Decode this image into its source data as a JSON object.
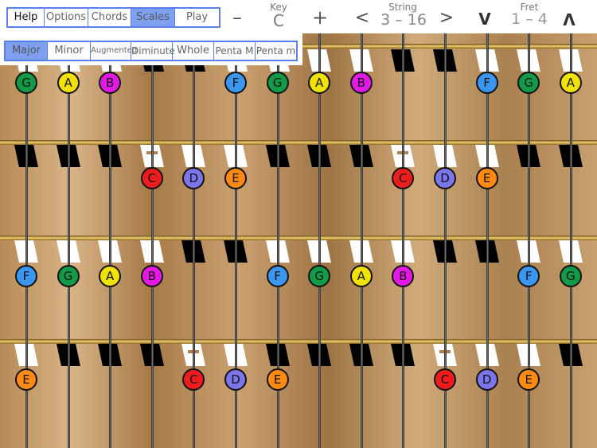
{
  "modes": [
    {
      "label": "Help",
      "selected": false
    },
    {
      "label": "Options",
      "selected": false
    },
    {
      "label": "Chords",
      "selected": false
    },
    {
      "label": "Scales",
      "selected": true
    },
    {
      "label": "Play",
      "selected": false
    }
  ],
  "scales": [
    {
      "label": "Major",
      "selected": true
    },
    {
      "label": "Minor",
      "selected": false
    },
    {
      "label": "Augmented",
      "selected": false
    },
    {
      "label": "Diminute",
      "selected": false
    },
    {
      "label": "Whole",
      "selected": false
    },
    {
      "label": "Penta M",
      "selected": false
    },
    {
      "label": "Penta m",
      "selected": false
    }
  ],
  "key": {
    "label": "Key",
    "value": "C",
    "minus": "–",
    "plus": "+"
  },
  "string": {
    "label": "String",
    "value": "3 – 16",
    "prev": "<",
    "next": ">"
  },
  "fret": {
    "label": "Fret",
    "value": "1 – 4",
    "down": "V",
    "up": "Λ"
  },
  "note_colors": {
    "C": "#ee1c1c",
    "D": "#7b74ea",
    "E": "#ff8a10",
    "F": "#3a96ee",
    "G": "#129a48",
    "A": "#f2e200",
    "B": "#e418e4"
  },
  "rows": [
    {
      "keys": "wwwbbwwwwbbwww",
      "notes": [
        "G",
        "A",
        "B",
        null,
        null,
        "F",
        "G",
        "A",
        "B",
        null,
        null,
        "F",
        "G",
        "A"
      ]
    },
    {
      "keys": "bbbwwwbbbwwwbb",
      "dashes": [
        3,
        9
      ],
      "notes": [
        null,
        null,
        null,
        "C",
        "D",
        "E",
        null,
        null,
        null,
        "C",
        "D",
        "E",
        null,
        null
      ]
    },
    {
      "keys": "wwwwbbwwwwbbww",
      "notes": [
        "F",
        "G",
        "A",
        "B",
        null,
        null,
        "F",
        "G",
        "A",
        "B",
        null,
        null,
        "F",
        "G"
      ]
    },
    {
      "keys": "wbbbwwbbbbwwwb",
      "dashes": [
        4,
        10
      ],
      "notes": [
        "E",
        null,
        null,
        null,
        "C",
        "D",
        "E",
        null,
        null,
        null,
        "C",
        "D",
        "E",
        null
      ]
    }
  ]
}
